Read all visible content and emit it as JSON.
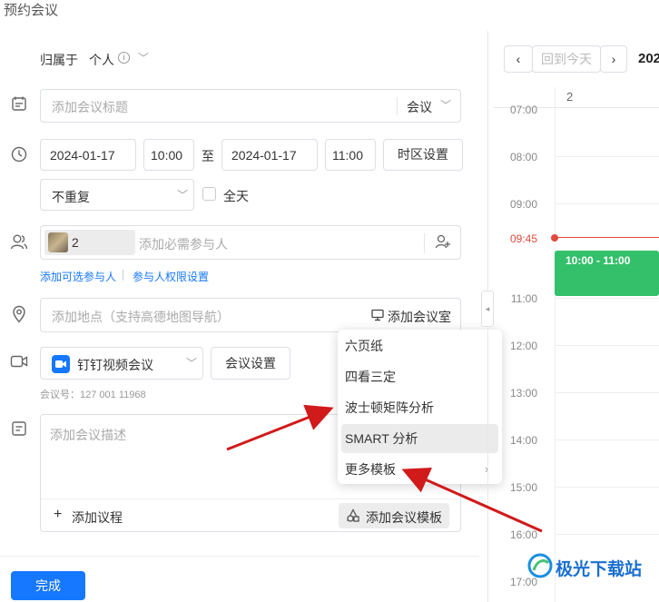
{
  "title": "预约会议",
  "owner": {
    "label": "归属于",
    "value": "个人"
  },
  "meeting_title": {
    "placeholder": "添加会议标题",
    "type": "会议"
  },
  "time": {
    "start_date": "2024-01-17",
    "start_time": "10:00",
    "to": "至",
    "end_date": "2024-01-17",
    "end_time": "11:00",
    "timezone_button": "时区设置",
    "repeat": "不重复",
    "all_day": "全天"
  },
  "participants": {
    "count": "2",
    "placeholder": "添加必需参与人",
    "optional_link": "添加可选参与人",
    "permission_link": "参与人权限设置"
  },
  "location": {
    "placeholder": "添加地点（支持高德地图导航）",
    "add_room": "添加会议室"
  },
  "video": {
    "provider": "钉钉视频会议",
    "settings_button": "会议设置",
    "meeting_number": "会议号：127 001 11968"
  },
  "description": {
    "placeholder": "添加会议描述",
    "add_agenda": "添加议程",
    "add_template": "添加会议模板"
  },
  "template_menu": {
    "items": [
      "六页纸",
      "四看三定",
      "波士顿矩阵分析",
      "SMART 分析",
      "更多模板"
    ],
    "active_index": 3
  },
  "done_button": "完成",
  "calendar": {
    "back_today": "回到今天",
    "year_partial": "202",
    "day_label": "2",
    "hours": [
      "07:00",
      "08:00",
      "09:00",
      "09:45",
      "11:00",
      "12:00",
      "13:00",
      "14:00",
      "15:00",
      "16:00",
      "17:00"
    ],
    "current_time": "09:45",
    "event_label": "10:00 - 11:00"
  },
  "watermark": "极光下载站",
  "colors": {
    "primary": "#1677ff",
    "event": "#34c06a",
    "now_line": "#e04a3a",
    "arrow": "#d11a1a"
  }
}
